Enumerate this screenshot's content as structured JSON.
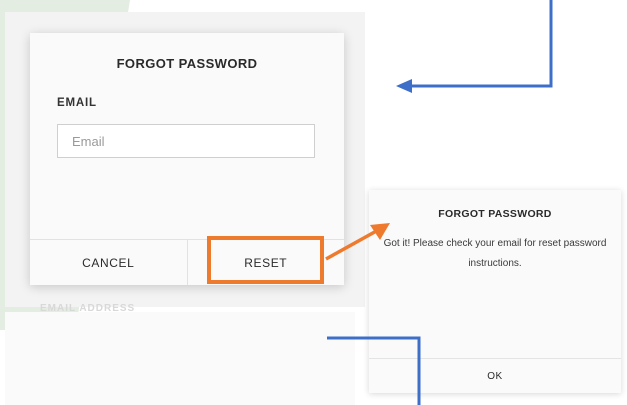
{
  "background": {
    "faded_label": "EMAIL ADDRESS"
  },
  "forgot_dialog": {
    "title": "FORGOT PASSWORD",
    "email_label": "EMAIL",
    "email_placeholder": "Email",
    "email_value": "",
    "cancel_label": "CANCEL",
    "reset_label": "RESET"
  },
  "confirmation_dialog": {
    "title": "FORGOT PASSWORD",
    "message": "Got it! Please check your email for reset password instructions.",
    "ok_label": "OK"
  },
  "colors": {
    "highlight": "#ee7a2e",
    "arrow_blue": "#3d6fc9",
    "bg_accent": "#e3ede1"
  }
}
